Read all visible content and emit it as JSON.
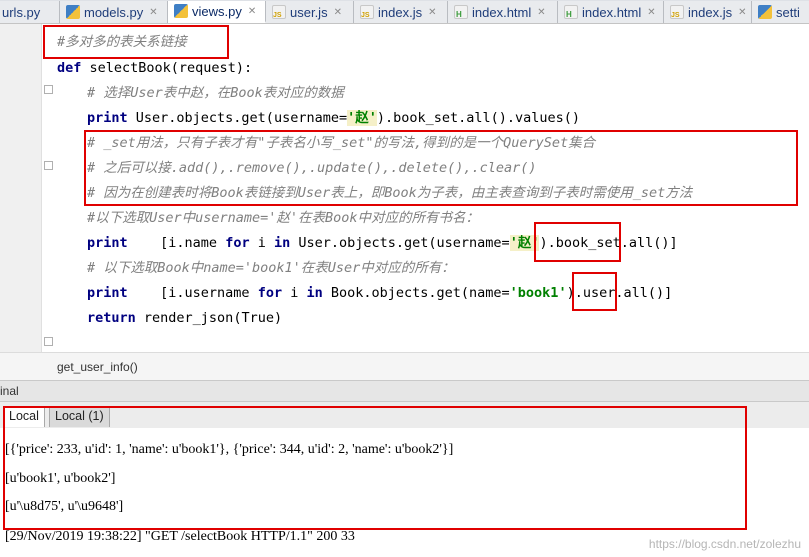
{
  "tabs": [
    {
      "label": "urls.py",
      "icon": "python-file-icon",
      "active": false
    },
    {
      "label": "models.py",
      "icon": "python-file-icon",
      "active": false
    },
    {
      "label": "views.py",
      "icon": "python-file-icon",
      "active": true
    },
    {
      "label": "user.js",
      "icon": "js-file-icon",
      "active": false
    },
    {
      "label": "index.js",
      "icon": "js-file-icon",
      "active": false
    },
    {
      "label": "index.html",
      "icon": "html-file-icon",
      "active": false
    },
    {
      "label": "index.html",
      "icon": "html-file-icon",
      "active": false
    },
    {
      "label": "index.js",
      "icon": "js-file-icon",
      "active": false
    },
    {
      "label": "setti",
      "icon": "python-file-icon",
      "active": false
    }
  ],
  "code": {
    "l1": "#多对多的表关系链接",
    "l2_kw": "def",
    "l2_rest": " selectBook(request):",
    "l3": "# 选择User表中赵，在Book表对应的数据",
    "l4_kw": "print",
    "l4_a": " User.objects.get(username=",
    "l4_str": "'赵'",
    "l4_b": ").book_set.all().values()",
    "l5": "# _set用法，只有子表才有\"子表名小写_set\"的写法,得到的是一个QuerySet集合",
    "l6": "# 之后可以接.add(),.remove(),.update(),.delete(),.clear()",
    "l7": "# 因为在创建表时将Book表链接到User表上，即Book为子表，由主表查询到子表时需使用_set方法",
    "l8": "#以下选取User中username='赵'在表Book中对应的所有书名：",
    "l9_kw": "print",
    "l9_a": "    [i.name ",
    "l9_kw2": "for",
    "l9_b": " i ",
    "l9_kw3": "in",
    "l9_c": " User.objects.get(username=",
    "l9_str": "'赵'",
    "l9_d": ").book_set.all()]",
    "l10": "# 以下选取Book中name='book1'在表User中对应的所有：",
    "l11_kw": "print",
    "l11_a": "    [i.username ",
    "l11_kw2": "for",
    "l11_b": " i ",
    "l11_kw3": "in",
    "l11_c": " Book.objects.get(name=",
    "l11_str": "'book1'",
    "l11_d": ").user.all()]",
    "l12_kw": "return",
    "l12_rest": " render_json(True)"
  },
  "breadcrumb": "get_user_info()",
  "terminal_header": "inal",
  "terminal_tabs": [
    "Local",
    "Local (1)"
  ],
  "terminal_lines": [
    "[{'price': 233, u'id': 1, 'name': u'book1'}, {'price': 344, u'id': 2, 'name': u'book2'}]",
    "[u'book1', u'book2']",
    "[u'\\u8d75', u'\\u9648']",
    "[29/Nov/2019 19:38:22] \"GET /selectBook HTTP/1.1\" 200 33"
  ],
  "watermark": "https://blog.csdn.net/zolezhu",
  "colors": {
    "highlight_box": "#e00000",
    "keyword": "#000080",
    "string": "#008000",
    "comment": "#808080"
  }
}
